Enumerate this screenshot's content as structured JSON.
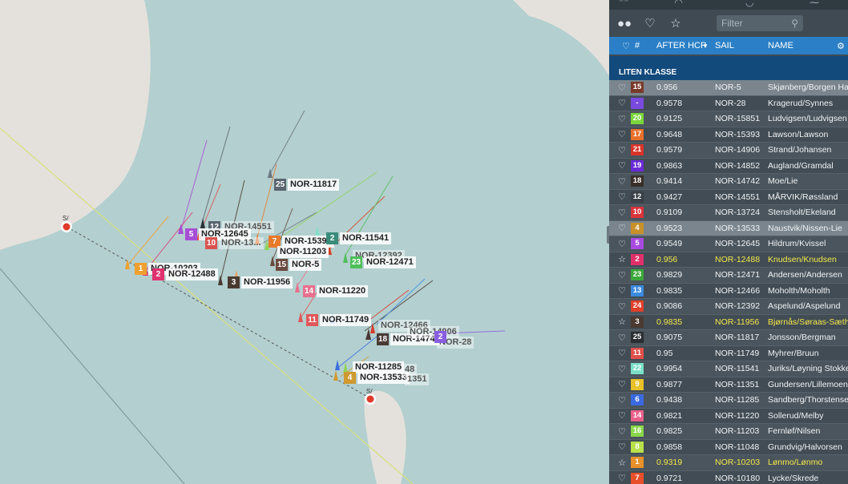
{
  "map": {
    "start_marks": [
      {
        "label": "S/",
        "kind": "start-mark"
      },
      {
        "label": "S/",
        "kind": "start-mark"
      }
    ],
    "boats": [
      {
        "num": "25",
        "sail": "NOR-11817",
        "color": "#5a6570"
      },
      {
        "num": "12",
        "sail": "NOR-14551",
        "color": "#5a6570",
        "faded": true
      },
      {
        "num": "5",
        "sail": "NOR-12645",
        "color": "#a64fd6"
      },
      {
        "num": "10",
        "sail": "NOR-13...",
        "color": "#d9534f"
      },
      {
        "num": "7",
        "sail": "NOR-15393",
        "color": "#e87a2c"
      },
      {
        "num": "2",
        "sail": "NOR-11541",
        "color": "#7fe0c9"
      },
      {
        "num": "",
        "sail": "NOR-11203",
        "color": "#8fd45a"
      },
      {
        "num": "15",
        "sail": "NOR-5",
        "color": "#6b4a3f"
      },
      {
        "num": "",
        "sail": "NOR-12392",
        "color": "#d6441f"
      },
      {
        "num": "23",
        "sail": "NOR-12471",
        "color": "#4fbf5a"
      },
      {
        "num": "1",
        "sail": "NOR-10203",
        "color": "#f0a030"
      },
      {
        "num": "2",
        "sail": "NOR-12488",
        "color": "#e0326e"
      },
      {
        "num": "3",
        "sail": "NOR-11956",
        "color": "#4a3a30"
      },
      {
        "num": "14",
        "sail": "NOR-11220",
        "color": "#e8708e"
      },
      {
        "num": "11",
        "sail": "NOR-11749",
        "color": "#e0585a"
      },
      {
        "num": "18",
        "sail": "NOR-14742",
        "color": "#4a3a36"
      },
      {
        "num": "",
        "sail": "NOR-12466",
        "color": "#3a8fe0"
      },
      {
        "num": "",
        "sail": "NOR-14906",
        "color": "#d83a2a"
      },
      {
        "num": "",
        "sail": "NOR-28",
        "color": "#8a5ee0"
      },
      {
        "num": "",
        "sail": "NOR-11285",
        "color": "#3a6ee0"
      },
      {
        "num": "4",
        "sail": "NOR-13533",
        "color": "#d09a30"
      },
      {
        "num": "",
        "sail": "1351",
        "color": "#8fd45a"
      },
      {
        "num": "",
        "sail": "48",
        "color": "#8fd45a"
      },
      {
        "num": "2",
        "sail": "",
        "color": "#8a5ee0"
      }
    ]
  },
  "panel": {
    "filter_placeholder": "Filter",
    "columns": {
      "rank": "#",
      "hcp": "AFTER HCP",
      "sail": "SAIL",
      "name": "NAME"
    },
    "class_title": "LITEN KLASSE",
    "rows": [
      {
        "fav": "heart",
        "rank": "15",
        "color": "#7a3a2a",
        "hcp": "0.956",
        "sail": "NOR-5",
        "name": "Skjønberg/Borgen Ha",
        "state": "sel"
      },
      {
        "fav": "heart",
        "rank": "-",
        "color": "#7a4ae0",
        "hcp": "0.9578",
        "sail": "NOR-28",
        "name": "Kragerud/Synnes"
      },
      {
        "fav": "heart",
        "rank": "20",
        "color": "#7ad63a",
        "hcp": "0.9125",
        "sail": "NOR-15851",
        "name": "Ludvigsen/Ludvigsen"
      },
      {
        "fav": "heart",
        "rank": "17",
        "color": "#e8702a",
        "hcp": "0.9648",
        "sail": "NOR-15393",
        "name": "Lawson/Lawson"
      },
      {
        "fav": "heart",
        "rank": "21",
        "color": "#d8342a",
        "hcp": "0.9579",
        "sail": "NOR-14906",
        "name": "Strand/Johansen"
      },
      {
        "fav": "heart",
        "rank": "19",
        "color": "#6a2ad6",
        "hcp": "0.9863",
        "sail": "NOR-14852",
        "name": "Augland/Gramdal"
      },
      {
        "fav": "heart",
        "rank": "18",
        "color": "#3a2e2a",
        "hcp": "0.9414",
        "sail": "NOR-14742",
        "name": "Moe/Lie"
      },
      {
        "fav": "heart",
        "rank": "12",
        "color": "#3a4048",
        "hcp": "0.9427",
        "sail": "NOR-14551",
        "name": "MÅRVIK/Røssland"
      },
      {
        "fav": "heart",
        "rank": "10",
        "color": "#d8343a",
        "hcp": "0.9109",
        "sail": "NOR-13724",
        "name": "Stensholt/Ekeland"
      },
      {
        "fav": "heart",
        "rank": "4",
        "color": "#c8902a",
        "hcp": "0.9523",
        "sail": "NOR-13533",
        "name": "Naustvik/Nissen-Lie",
        "state": "sel"
      },
      {
        "fav": "heart",
        "rank": "5",
        "color": "#a84ae0",
        "hcp": "0.9549",
        "sail": "NOR-12645",
        "name": "Hildrum/Kvissel"
      },
      {
        "fav": "star",
        "rank": "2",
        "color": "#e0306a",
        "hcp": "0.956",
        "sail": "NOR-12488",
        "name": "Knudsen/Knudsen",
        "state": "hl"
      },
      {
        "fav": "heart",
        "rank": "23",
        "color": "#3aa83a",
        "hcp": "0.9829",
        "sail": "NOR-12471",
        "name": "Andersen/Andersen"
      },
      {
        "fav": "heart",
        "rank": "13",
        "color": "#3a8ae0",
        "hcp": "0.9835",
        "sail": "NOR-12466",
        "name": "Moholth/Moholth"
      },
      {
        "fav": "heart",
        "rank": "24",
        "color": "#e0402a",
        "hcp": "0.9086",
        "sail": "NOR-12392",
        "name": "Aspelund/Aspelund"
      },
      {
        "fav": "star",
        "rank": "3",
        "color": "#4a3a30",
        "hcp": "0.9835",
        "sail": "NOR-11956",
        "name": "Bjørnås/Søraas-Sæther",
        "state": "hl"
      },
      {
        "fav": "heart",
        "rank": "25",
        "color": "#2a2e32",
        "hcp": "0.9075",
        "sail": "NOR-11817",
        "name": "Jonsson/Bergman"
      },
      {
        "fav": "heart",
        "rank": "11",
        "color": "#e0504a",
        "hcp": "0.95",
        "sail": "NOR-11749",
        "name": "Myhrer/Bruun"
      },
      {
        "fav": "heart",
        "rank": "22",
        "color": "#7ae0c8",
        "hcp": "0.9954",
        "sail": "NOR-11541",
        "name": "Juriks/Løyning Stokke"
      },
      {
        "fav": "heart",
        "rank": "9",
        "color": "#e8c02a",
        "hcp": "0.9877",
        "sail": "NOR-11351",
        "name": "Gundersen/Lillemoen"
      },
      {
        "fav": "heart",
        "rank": "6",
        "color": "#3a6ae0",
        "hcp": "0.9438",
        "sail": "NOR-11285",
        "name": "Sandberg/Thorstensen"
      },
      {
        "fav": "heart",
        "rank": "14",
        "color": "#e8608a",
        "hcp": "0.9821",
        "sail": "NOR-11220",
        "name": "Sollerud/Melby"
      },
      {
        "fav": "heart",
        "rank": "16",
        "color": "#8ad64a",
        "hcp": "0.9825",
        "sail": "NOR-11203",
        "name": "Fernløf/Nilsen"
      },
      {
        "fav": "heart",
        "rank": "8",
        "color": "#b8e04a",
        "hcp": "0.9858",
        "sail": "NOR-11048",
        "name": "Grundvig/Halvorsen"
      },
      {
        "fav": "star",
        "rank": "1",
        "color": "#e8902a",
        "hcp": "0.9319",
        "sail": "NOR-10203",
        "name": "Lønmo/Lønmo",
        "state": "hl"
      },
      {
        "fav": "heart",
        "rank": "7",
        "color": "#e8502a",
        "hcp": "0.9721",
        "sail": "NOR-10180",
        "name": "Lycke/Skrede"
      }
    ]
  }
}
